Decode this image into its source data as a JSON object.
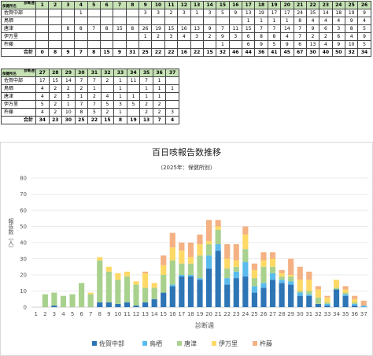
{
  "table": {
    "corner_week": "診断週",
    "corner_center": "保健所名",
    "total_label": "合計",
    "rows": [
      "佐賀中部",
      "鳥栖",
      "唐津",
      "伊万里",
      "杵藤"
    ],
    "part1": {
      "weeks": [
        "1",
        "2",
        "3",
        "4",
        "5",
        "6",
        "7",
        "8",
        "9",
        "10",
        "11",
        "12",
        "13",
        "14",
        "15",
        "16",
        "17",
        "18",
        "19",
        "20",
        "21",
        "22",
        "23",
        "24",
        "25",
        "26"
      ],
      "cells": [
        [
          "",
          "",
          "",
          "1",
          "",
          "",
          "",
          "",
          "3",
          "3",
          "2",
          "3",
          "1",
          "3",
          "5",
          "9",
          "13",
          "19",
          "17",
          "17",
          "24",
          "35",
          "14",
          "18",
          "19",
          "9",
          "12"
        ],
        [
          "",
          "",
          "",
          "",
          "",
          "",
          "",
          "",
          "",
          "",
          "",
          "",
          "",
          "",
          "",
          "",
          "1",
          "1",
          "1",
          "1",
          "8",
          "4",
          "4",
          "4",
          "9",
          "4",
          "3"
        ],
        [
          "",
          "",
          "8",
          "8",
          "7",
          "8",
          "15",
          "8",
          "26",
          "19",
          "15",
          "16",
          "13",
          "9",
          "7",
          "11",
          "15",
          "7",
          "7",
          "14",
          "7",
          "9",
          "6",
          "3",
          "8",
          "5",
          "10"
        ],
        [
          "",
          "",
          "",
          "",
          "",
          "",
          "",
          "",
          "1",
          "2",
          "3",
          "4",
          "3",
          "2",
          "9",
          "3",
          "6",
          "8",
          "8",
          "4",
          "7",
          "2",
          "2",
          "6",
          "4",
          "9",
          "5"
        ],
        [
          "",
          "",
          "",
          "",
          "",
          "",
          "",
          "",
          "",
          "",
          "",
          "",
          "",
          "",
          "1",
          "",
          "6",
          "9",
          "5",
          "9",
          "6",
          "13",
          "4",
          "9",
          "10",
          "5",
          "4"
        ]
      ],
      "totals": [
        "0",
        "8",
        "9",
        "7",
        "8",
        "15",
        "9",
        "31",
        "25",
        "22",
        "22",
        "16",
        "22",
        "15",
        "32",
        "46",
        "44",
        "36",
        "41",
        "45",
        "67",
        "30",
        "40",
        "50",
        "32",
        "34"
      ]
    },
    "part2": {
      "weeks": [
        "27",
        "28",
        "29",
        "30",
        "31",
        "32",
        "33",
        "34",
        "35",
        "36",
        "37"
      ],
      "cells": [
        [
          "17",
          "15",
          "14",
          "7",
          "7",
          "2",
          "1",
          "11",
          "7",
          "1",
          ""
        ],
        [
          "4",
          "2",
          "2",
          "2",
          "1",
          "",
          "1",
          "",
          "1",
          "1",
          "1"
        ],
        [
          "4",
          "2",
          "3",
          "1",
          "2",
          "4",
          "1",
          "1",
          "1",
          "1",
          ""
        ],
        [
          "5",
          "2",
          "1",
          "7",
          "7",
          "5",
          "3",
          "5",
          "2",
          "2",
          ""
        ],
        [
          "4",
          "2",
          "10",
          "8",
          "5",
          "2",
          "1",
          "",
          "2",
          "2",
          "3"
        ]
      ],
      "totals": [
        "34",
        "23",
        "30",
        "25",
        "22",
        "15",
        "8",
        "19",
        "13",
        "7",
        "4"
      ]
    }
  },
  "chart": {
    "title": "百日咳報告数推移",
    "subtitle": "（2025年：保健所別）",
    "xlabel": "診断週",
    "ylabel": "報告数（人）"
  },
  "chart_data": {
    "type": "bar",
    "stacked": true,
    "categories": [
      "1",
      "2",
      "3",
      "4",
      "5",
      "6",
      "7",
      "8",
      "9",
      "10",
      "11",
      "12",
      "13",
      "14",
      "15",
      "16",
      "17",
      "18",
      "19",
      "20",
      "21",
      "22",
      "23",
      "24",
      "25",
      "26",
      "27",
      "28",
      "29",
      "30",
      "31",
      "32",
      "33",
      "34",
      "35",
      "36",
      "37"
    ],
    "series": [
      {
        "name": "佐賀中部",
        "color": "#2e75b6",
        "values": [
          0,
          0,
          1,
          0,
          0,
          0,
          0,
          3,
          3,
          2,
          3,
          1,
          3,
          5,
          9,
          13,
          19,
          19,
          17,
          24,
          35,
          14,
          18,
          19,
          9,
          12,
          17,
          15,
          14,
          7,
          7,
          2,
          1,
          11,
          7,
          1,
          0
        ]
      },
      {
        "name": "鳥栖",
        "color": "#5bbcec",
        "values": [
          0,
          0,
          0,
          0,
          0,
          0,
          0,
          0,
          0,
          0,
          0,
          0,
          0,
          0,
          0,
          1,
          1,
          1,
          1,
          8,
          4,
          4,
          4,
          9,
          4,
          3,
          4,
          2,
          2,
          2,
          1,
          0,
          1,
          0,
          1,
          1,
          1
        ]
      },
      {
        "name": "唐津",
        "color": "#a9d18e",
        "values": [
          0,
          8,
          8,
          7,
          8,
          15,
          8,
          26,
          19,
          15,
          16,
          13,
          9,
          7,
          11,
          15,
          7,
          7,
          14,
          7,
          9,
          6,
          3,
          8,
          5,
          10,
          4,
          2,
          3,
          1,
          2,
          4,
          1,
          1,
          1,
          1,
          0
        ]
      },
      {
        "name": "伊万里",
        "color": "#ffd966",
        "values": [
          0,
          0,
          0,
          0,
          0,
          0,
          1,
          2,
          3,
          4,
          3,
          2,
          9,
          3,
          6,
          8,
          8,
          4,
          7,
          2,
          2,
          6,
          4,
          9,
          5,
          4,
          5,
          2,
          1,
          7,
          7,
          5,
          3,
          5,
          2,
          2,
          0
        ]
      },
      {
        "name": "杵藤",
        "color": "#f4b183",
        "values": [
          0,
          0,
          0,
          0,
          0,
          0,
          0,
          0,
          0,
          0,
          0,
          0,
          1,
          0,
          6,
          9,
          5,
          9,
          6,
          13,
          4,
          9,
          10,
          5,
          4,
          5,
          4,
          2,
          10,
          8,
          5,
          2,
          1,
          0,
          2,
          2,
          3
        ]
      }
    ],
    "ylim": [
      0,
      80
    ],
    "yticks": [
      0,
      10,
      20,
      30,
      40,
      50,
      60,
      70,
      80
    ],
    "grid": true,
    "legend": "bottom"
  }
}
